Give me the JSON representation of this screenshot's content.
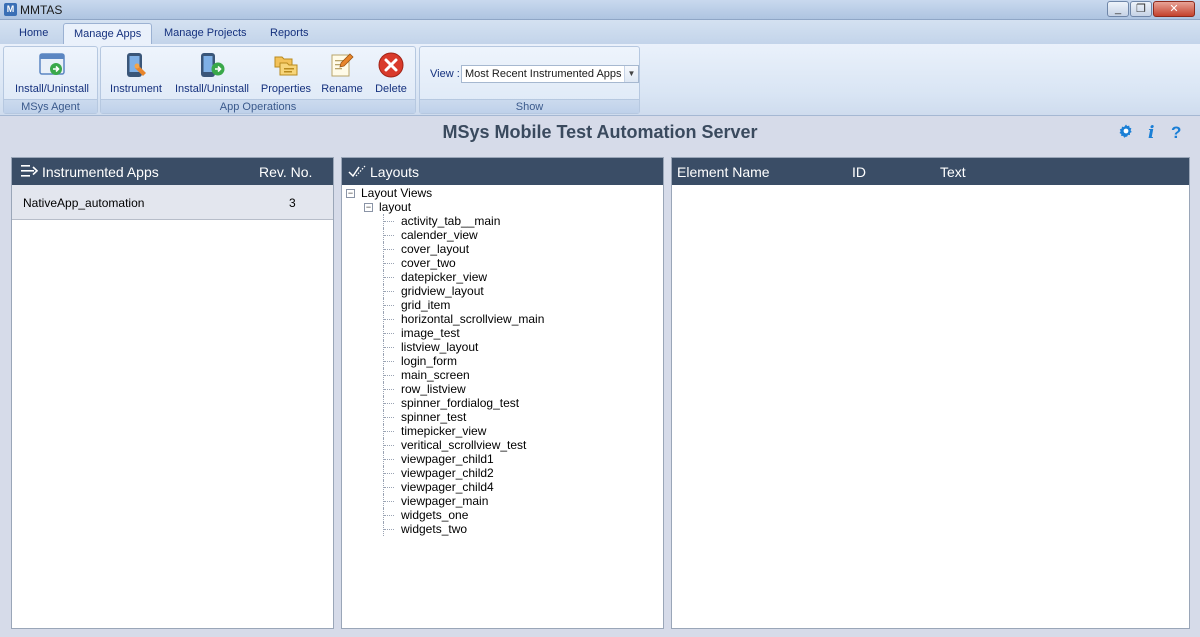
{
  "window": {
    "title": "MMTAS"
  },
  "tabs": [
    "Home",
    "Manage Apps",
    "Manage Projects",
    "Reports"
  ],
  "ribbon": {
    "groups": [
      {
        "label": "MSys Agent",
        "buttons": [
          "Install/Uninstall"
        ]
      },
      {
        "label": "App Operations",
        "buttons": [
          "Instrument",
          "Install/Uninstall",
          "Properties",
          "Rename",
          "Delete"
        ]
      },
      {
        "label": "Show",
        "view_label": "View :",
        "view_value": "Most Recent Instrumented Apps"
      }
    ]
  },
  "header": {
    "title": "MSys Mobile Test Automation Server",
    "info_icon": "i",
    "help_icon": "?"
  },
  "apps_panel": {
    "title": "Instrumented Apps",
    "rev_header": "Rev. No.",
    "rows": [
      {
        "name": "NativeApp_automation",
        "rev": "3"
      }
    ]
  },
  "layouts_panel": {
    "title": "Layouts",
    "root": "Layout Views",
    "folder": "layout",
    "items": [
      "activity_tab__main",
      "calender_view",
      "cover_layout",
      "cover_two",
      "datepicker_view",
      "gridview_layout",
      "grid_item",
      "horizontal_scrollview_main",
      "image_test",
      "listview_layout",
      "login_form",
      "main_screen",
      "row_listview",
      "spinner_fordialog_test",
      "spinner_test",
      "timepicker_view",
      "veritical_scrollview_test",
      "viewpager_child1",
      "viewpager_child2",
      "viewpager_child4",
      "viewpager_main",
      "widgets_one",
      "widgets_two"
    ]
  },
  "elements_panel": {
    "columns": [
      "Element Name",
      "ID",
      "Text"
    ]
  },
  "colors": {
    "panel_header": "#3a4d66",
    "accent": "#1a7fd6",
    "delete_red": "#d93a2b"
  }
}
